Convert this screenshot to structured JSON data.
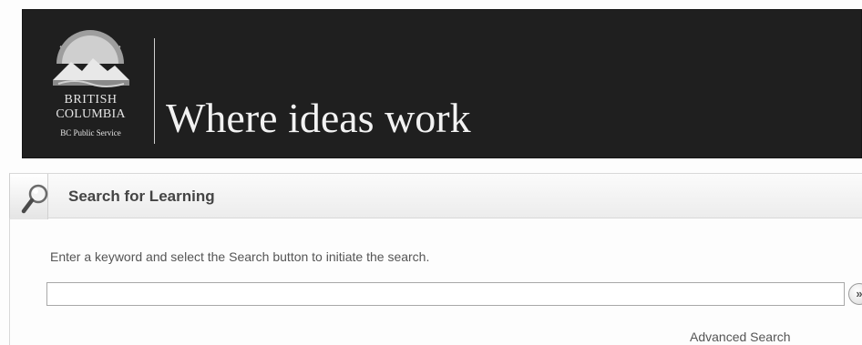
{
  "header": {
    "logo_line1": "BRITISH",
    "logo_line2": "COLUMBIA",
    "logo_line3": "BC Public Service",
    "tagline": "Where ideas work"
  },
  "search_panel": {
    "title": "Search for Learning",
    "instructions": "Enter a keyword and select the Search button to initiate the search.",
    "input_value": "",
    "input_placeholder": "",
    "go_button_glyph": "»",
    "advanced_link": "Advanced Search"
  },
  "icons": {
    "logo": "bc-sun-mountain-logo",
    "panel": "magnifier-icon",
    "go": "double-chevron-right-icon"
  },
  "colors": {
    "banner_background": "#1f1f1f",
    "banner_text": "#f2f2f2",
    "panel_title": "#444444",
    "body_text": "#555555"
  }
}
